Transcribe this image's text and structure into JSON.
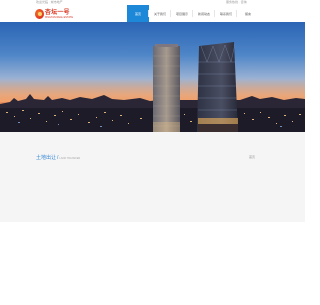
{
  "topbar": {
    "left_text": "欢迎光临 · 城市地产",
    "right_text": "服务热线 · 咨询"
  },
  "logo": {
    "name_cn": "杏坛一号",
    "name_en": "XINGTAN REAL ESTATE"
  },
  "nav": {
    "items": [
      {
        "label": "首页",
        "active": true
      },
      {
        "label": "关于我们",
        "active": false
      },
      {
        "label": "项目展示",
        "active": false
      },
      {
        "label": "新闻动态",
        "active": false
      },
      {
        "label": "联系我们",
        "active": false
      },
      {
        "label": "留言",
        "active": false
      }
    ]
  },
  "hero": {
    "image": "city-skyline-at-dusk"
  },
  "content": {
    "breadcrumb_title": "土地出让",
    "breadcrumb_sub": "LAND TRANSFER",
    "right_text": "首页"
  },
  "colors": {
    "accent": "#1e88d8",
    "brand": "#d93621",
    "link": "#2d83d4",
    "content_bg": "#f5f5f5"
  }
}
